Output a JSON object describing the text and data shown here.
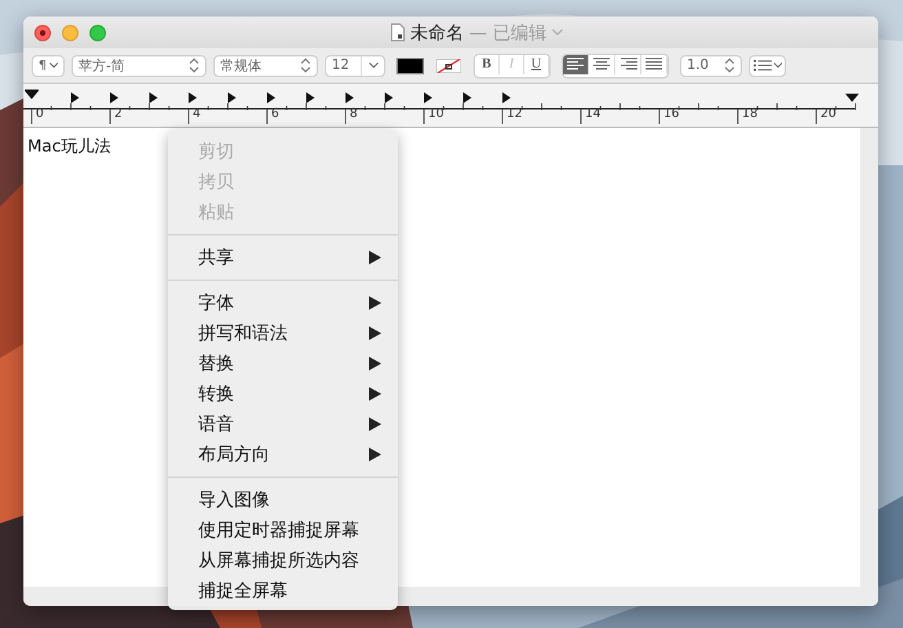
{
  "window": {
    "title": "未命名",
    "subtitle": "— 已编辑"
  },
  "toolbar": {
    "paragraph_button": "¶",
    "font_family": "苹方-简",
    "font_style": "常规体",
    "font_size": "12",
    "style_buttons": [
      {
        "label": "B",
        "selected": false
      },
      {
        "label": "I",
        "selected": false
      },
      {
        "label": "U",
        "selected": false
      }
    ],
    "alignment": [
      {
        "kind": "left",
        "selected": true
      },
      {
        "kind": "center",
        "selected": false
      },
      {
        "kind": "right",
        "selected": false
      },
      {
        "kind": "justify",
        "selected": false
      }
    ],
    "line_spacing": "1.0"
  },
  "ruler": {
    "labels": [
      "0",
      "2",
      "4",
      "6",
      "8",
      "10",
      "12",
      "14",
      "16",
      "18",
      "20"
    ]
  },
  "document": {
    "text": "Mac玩儿法"
  },
  "context_menu": {
    "groups": [
      [
        {
          "label": "剪切",
          "disabled": true,
          "submenu": false
        },
        {
          "label": "拷贝",
          "disabled": true,
          "submenu": false
        },
        {
          "label": "粘贴",
          "disabled": true,
          "submenu": false
        }
      ],
      [
        {
          "label": "共享",
          "disabled": false,
          "submenu": true
        }
      ],
      [
        {
          "label": "字体",
          "disabled": false,
          "submenu": true
        },
        {
          "label": "拼写和语法",
          "disabled": false,
          "submenu": true
        },
        {
          "label": "替换",
          "disabled": false,
          "submenu": true
        },
        {
          "label": "转换",
          "disabled": false,
          "submenu": true
        },
        {
          "label": "语音",
          "disabled": false,
          "submenu": true
        },
        {
          "label": "布局方向",
          "disabled": false,
          "submenu": true
        }
      ],
      [
        {
          "label": "导入图像",
          "disabled": false,
          "submenu": false
        },
        {
          "label": "使用定时器捕捉屏幕",
          "disabled": false,
          "submenu": false
        },
        {
          "label": "从屏幕捕捉所选内容",
          "disabled": false,
          "submenu": false
        },
        {
          "label": "捕捉全屏幕",
          "disabled": false,
          "submenu": false
        }
      ]
    ]
  }
}
